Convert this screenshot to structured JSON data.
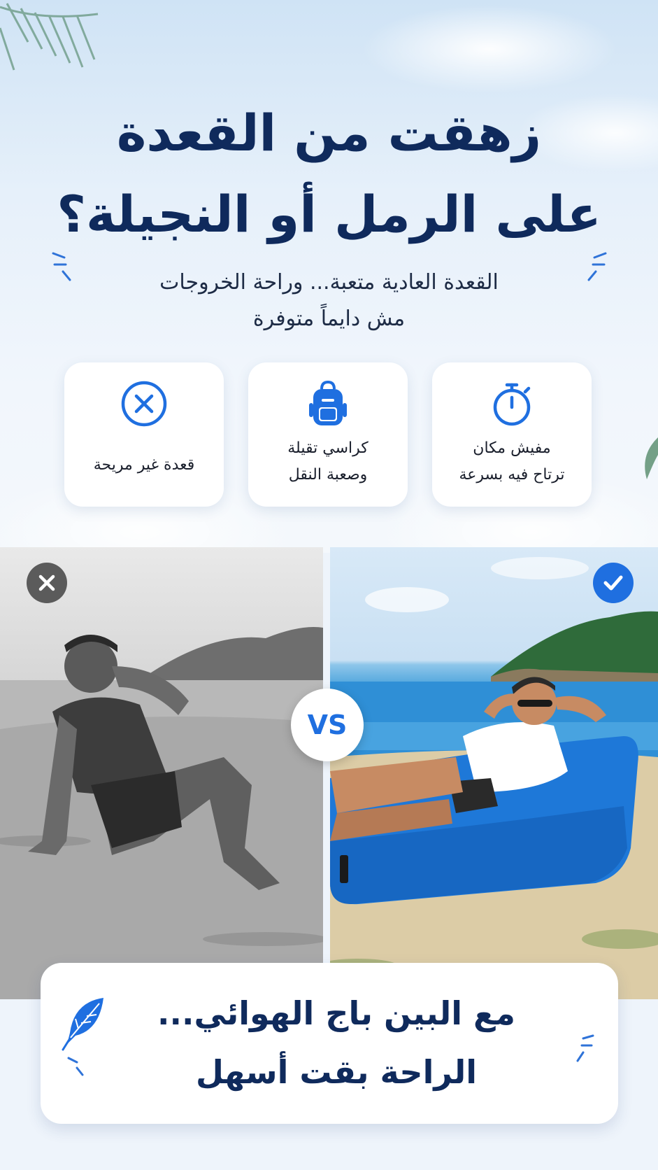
{
  "headline": {
    "line1": "زهقت من القعدة",
    "line2": "على الرمل أو النجيلة؟"
  },
  "subheadline": {
    "line1": "القعدة العادية متعبة... وراحة الخروجات",
    "line2": "مش دايماً متوفرة"
  },
  "pain_points": [
    {
      "icon": "stopwatch-icon",
      "line1": "مفيش مكان",
      "line2": "ترتاح فيه بسرعة"
    },
    {
      "icon": "backpack-icon",
      "line1": "كراسي تقيلة",
      "line2": "وصعبة النقل"
    },
    {
      "icon": "x-circle-icon",
      "line1": "قعدة غير مريحة",
      "line2": ""
    }
  ],
  "comparison": {
    "vs_label": "VS",
    "before_badge_icon": "close-icon",
    "after_badge_icon": "check-icon"
  },
  "bottom_banner": {
    "line1": "مع البين باج الهوائي...",
    "line2": "الراحة  بقت أسهل",
    "icon": "feather-icon"
  },
  "colors": {
    "headline": "#0f2a5c",
    "accent_blue": "#1f6fe0",
    "card_bg": "#ffffff",
    "sofa_blue": "#1e78d8"
  }
}
